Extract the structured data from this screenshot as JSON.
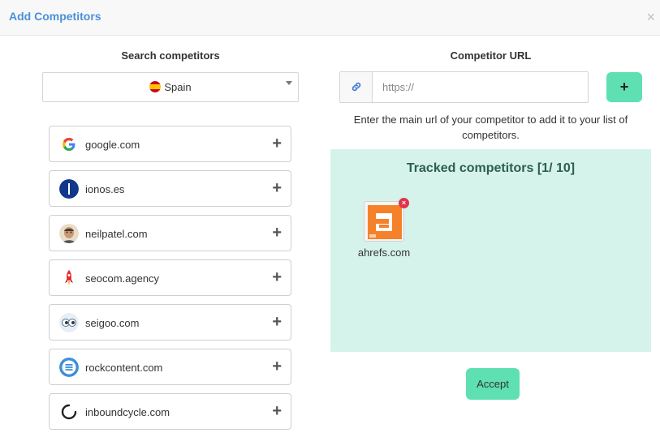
{
  "modal": {
    "title": "Add Competitors",
    "close_label": "×"
  },
  "search": {
    "title": "Search competitors",
    "country": {
      "selected": "Spain",
      "flag_icon": "flag-spain-icon"
    }
  },
  "competitors": [
    {
      "name": "google.com",
      "icon": "google-logo-icon"
    },
    {
      "name": "ionos.es",
      "icon": "ionos-logo-icon"
    },
    {
      "name": "neilpatel.com",
      "icon": "neilpatel-avatar-icon"
    },
    {
      "name": "seocom.agency",
      "icon": "rocket-logo-icon"
    },
    {
      "name": "seigoo.com",
      "icon": "eyes-logo-icon"
    },
    {
      "name": "rockcontent.com",
      "icon": "rockcontent-logo-icon"
    },
    {
      "name": "inboundcycle.com",
      "icon": "circle-logo-icon"
    }
  ],
  "add_symbol": "+",
  "url_section": {
    "title": "Competitor URL",
    "placeholder": "https://",
    "value": "",
    "link_icon": "link-icon",
    "add_label": "+",
    "help": "Enter the main url of your competitor to add it to your list of competitors."
  },
  "tracked": {
    "title": "Tracked competitors [1/ 10]",
    "items": [
      {
        "name": "ahrefs.com",
        "icon": "ahrefs-logo-icon",
        "remove_label": "×"
      }
    ]
  },
  "accept_label": "Accept",
  "colors": {
    "accent": "#5ee0b2",
    "title_blue": "#4a90d9",
    "tracked_bg": "#d6f3eb",
    "remove_red": "#e0334c"
  }
}
